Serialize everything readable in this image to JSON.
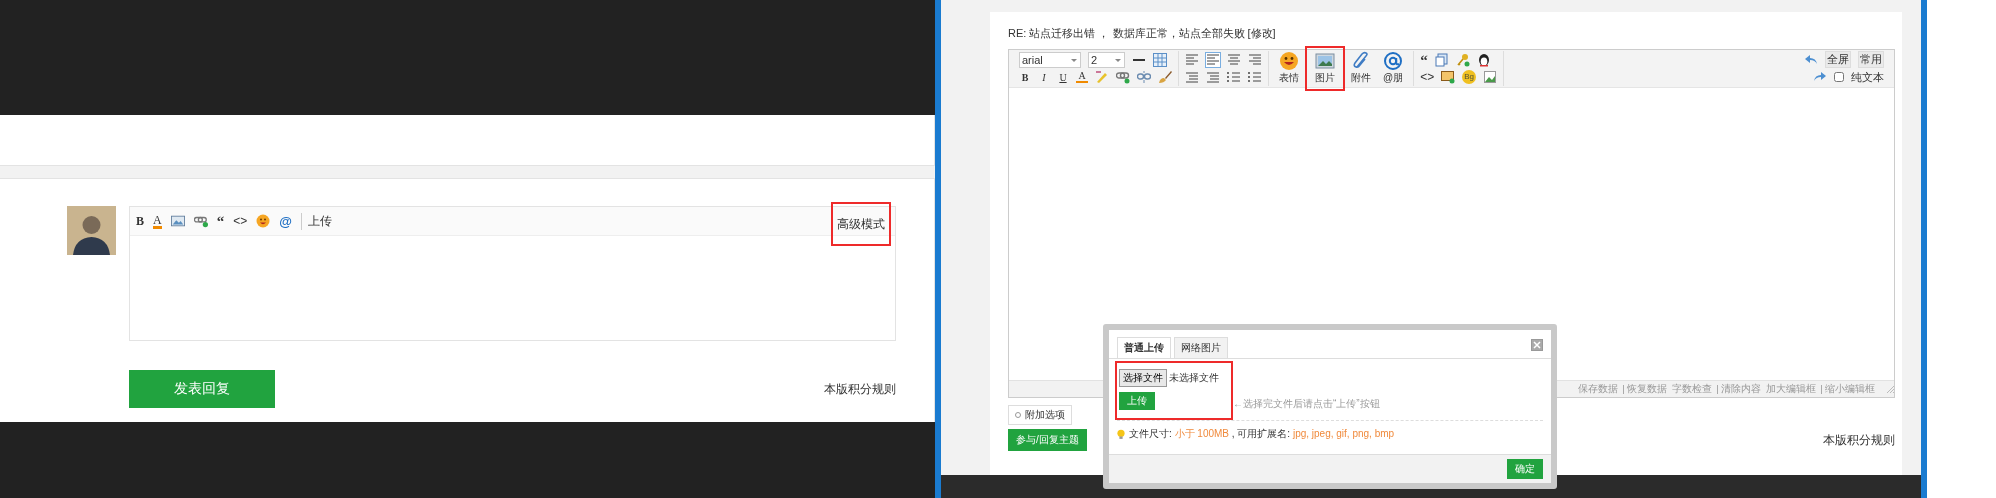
{
  "left": {
    "editor": {
      "bold": "B",
      "font_color": "A",
      "quote": "“",
      "code": "<>",
      "at": "@",
      "upload": "上传",
      "advanced": {
        "label": "高级模式",
        "highlighted": true
      }
    },
    "submit": "发表回复",
    "rules_link": "本版积分规则"
  },
  "right": {
    "title": "RE: 站点迁移出错 ， 数据库正常，站点全部失败 [修改]",
    "toolbar": {
      "font": "arial",
      "size": "2",
      "format": [
        "B",
        "I",
        "U",
        "A"
      ],
      "big_buttons": [
        {
          "label": "表情",
          "highlighted": false
        },
        {
          "label": "图片",
          "highlighted": true
        },
        {
          "label": "附件",
          "highlighted": false
        },
        {
          "label": "@朋",
          "highlighted": false
        }
      ],
      "quote": "“",
      "code": "<>",
      "bg": "Bg",
      "fullscreen": "全屏",
      "common": "常用",
      "plain_text": {
        "label": "纯文本",
        "checked": false
      }
    },
    "status_groups": [
      [
        "保存数据",
        "恢复数据"
      ],
      [
        "字数检查",
        "清除内容"
      ],
      [
        "加大编辑框",
        "缩小编辑框"
      ]
    ],
    "extra_options": "附加选项",
    "reply_button": "参与/回复主题",
    "rules_link": "本版积分规则"
  },
  "dialog": {
    "tabs": [
      {
        "label": "普通上传",
        "selected": true
      },
      {
        "label": "网络图片",
        "selected": false
      }
    ],
    "file_button": "选择文件",
    "file_status": "未选择文件",
    "file_highlighted": true,
    "upload_button": "上传",
    "hint": "←选择完文件后请点击“上传”按钮",
    "info": [
      {
        "kind": "label",
        "text": "文件尺寸: "
      },
      {
        "kind": "value",
        "text": "小于 100MB"
      },
      {
        "kind": "label",
        "text": " , 可用扩展名: "
      },
      {
        "kind": "value",
        "text": "jpg, jpeg, gif, png, bmp"
      }
    ],
    "ok_button": "确定"
  }
}
